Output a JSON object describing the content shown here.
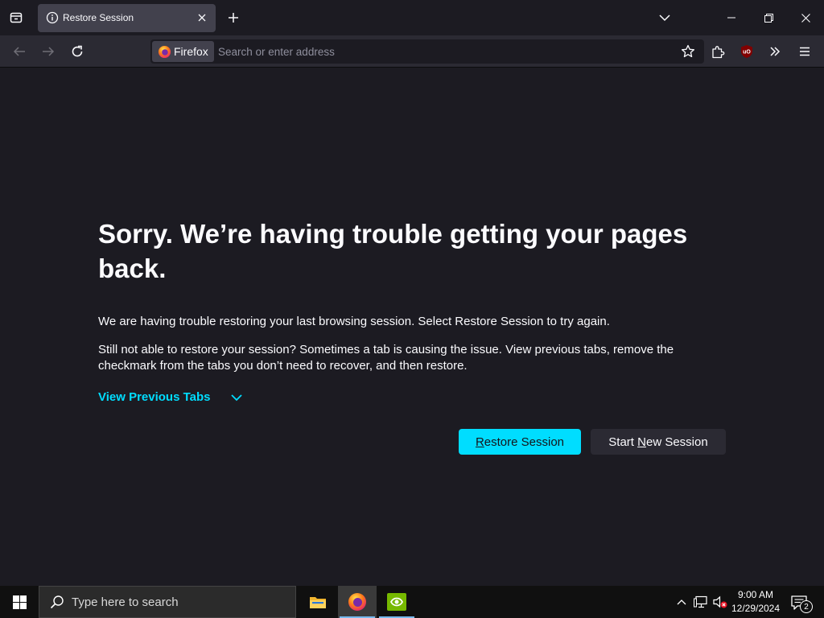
{
  "tab": {
    "title": "Restore Session"
  },
  "urlbar": {
    "identity_label": "Firefox",
    "placeholder": "Search or enter address"
  },
  "page": {
    "title": "Sorry. We’re having trouble getting your pages back.",
    "paragraph1": "We are having trouble restoring your last browsing session. Select Restore Session to try again.",
    "paragraph2": "Still not able to restore your session? Sometimes a tab is causing the issue. View previous tabs, remove the checkmark from the tabs you don’t need to recover, and then restore.",
    "view_previous_tabs": "View Previous Tabs",
    "restore_button": {
      "prefix": "",
      "accel": "R",
      "rest": "estore Session"
    },
    "new_session_button": {
      "prefix": "Start ",
      "accel": "N",
      "rest": "ew Session"
    }
  },
  "taskbar": {
    "search_placeholder": "Type here to search",
    "apps": [
      "file-explorer",
      "firefox",
      "nvidia"
    ],
    "clock": {
      "time": "9:00 AM",
      "date": "12/29/2024"
    },
    "notification_count": "2"
  },
  "colors": {
    "accent": "#00ddff",
    "background": "#1c1b22",
    "toolbar": "#2b2a33",
    "tab_selected": "#42414d"
  }
}
